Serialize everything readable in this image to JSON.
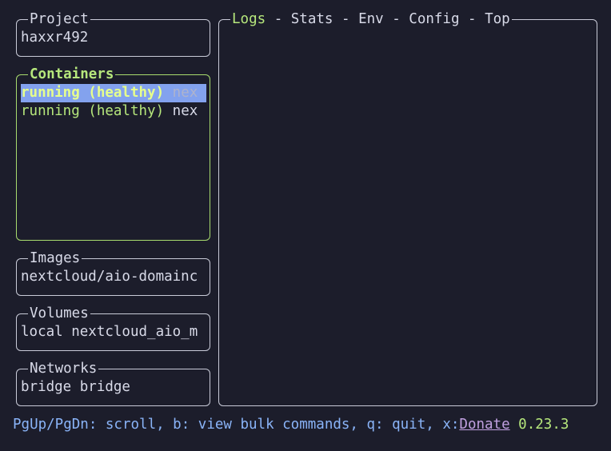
{
  "project": {
    "title": "Project",
    "name": "haxxr492"
  },
  "containers": {
    "title": "Containers",
    "items": [
      {
        "state": "running (healthy)",
        "name": "nex"
      },
      {
        "state": "running (healthy)",
        "name": "nex"
      }
    ]
  },
  "images": {
    "title": "Images",
    "item": "nextcloud/aio-domainc"
  },
  "volumes": {
    "title": "Volumes",
    "item": "local nextcloud_aio_m"
  },
  "networks": {
    "title": "Networks",
    "item": "bridge bridge"
  },
  "logs_panel": {
    "tabs": [
      "Logs",
      "Stats",
      "Env",
      "Config",
      "Top"
    ],
    "separator": " - "
  },
  "status_bar": {
    "help": "PgUp/PgDn: scroll, b: view bulk commands, q: quit, x:",
    "donate": "Donate",
    "version": "0.23.3"
  },
  "colors": {
    "background": "#1c1d2b",
    "accent_green": "#b6e77c",
    "selection": "#83a2ee",
    "status_blue": "#8ab4f8",
    "donate_purple": "#c0a0e0",
    "border": "#c9cbd8"
  }
}
